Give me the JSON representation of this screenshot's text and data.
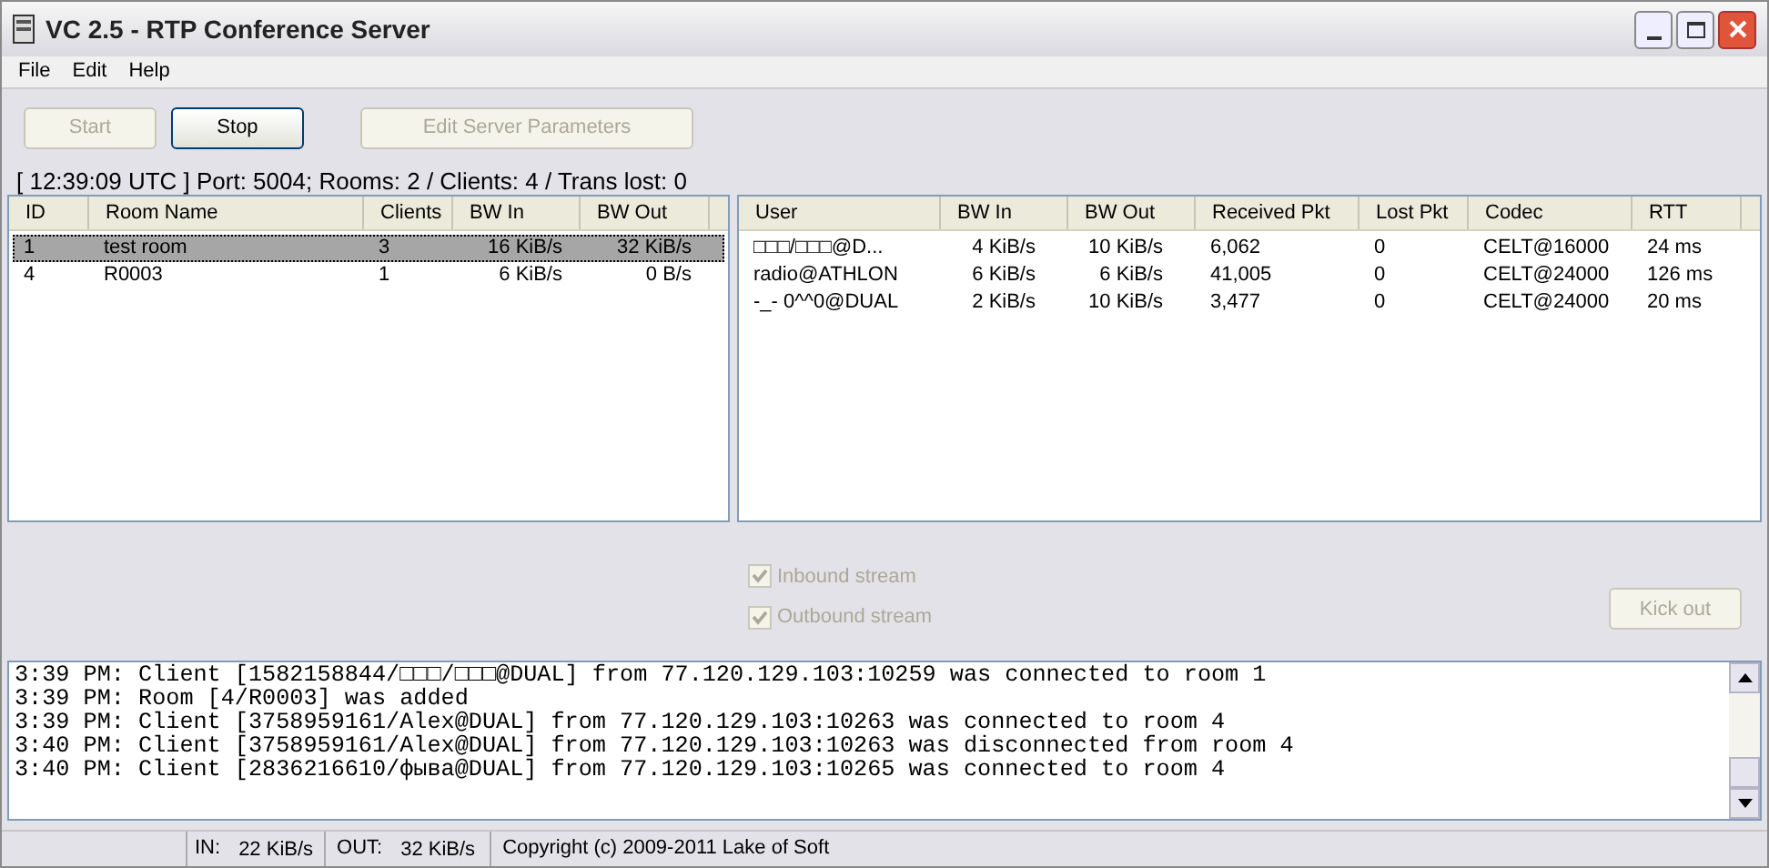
{
  "window": {
    "title": "VC 2.5 - RTP Conference Server"
  },
  "menu": [
    {
      "label": "File"
    },
    {
      "label": "Edit"
    },
    {
      "label": "Help"
    }
  ],
  "toolbar": [
    {
      "label": "Start",
      "disabled": true
    },
    {
      "label": "Stop",
      "disabled": false
    },
    {
      "label": "Edit Server Parameters",
      "disabled": true
    }
  ],
  "status_line": "[ 12:39:09 UTC ] Port: 5004; Rooms: 2 / Clients: 4 / Trans lost: 0",
  "rooms": {
    "columns": [
      "ID",
      "Room Name",
      "Clients",
      "BW In",
      "BW Out"
    ],
    "rows": [
      {
        "cells": [
          "1",
          "test room",
          "3",
          "16 KiB/s",
          "32 KiB/s"
        ],
        "selected": true
      },
      {
        "cells": [
          "4",
          "R0003",
          "1",
          "6 KiB/s",
          "0 B/s"
        ],
        "selected": false
      }
    ]
  },
  "users": {
    "columns": [
      "User",
      "BW In",
      "BW Out",
      "Received Pkt",
      "Lost Pkt",
      "Codec",
      "RTT"
    ],
    "rows": [
      {
        "cells": [
          "□□□/□□□@D...",
          "4 KiB/s",
          "10 KiB/s",
          "6,062",
          "0",
          "CELT@16000",
          "24 ms"
        ],
        "selected": false
      },
      {
        "cells": [
          "radio@ATHLON",
          "6 KiB/s",
          "6 KiB/s",
          "41,005",
          "0",
          "CELT@24000",
          "126 ms"
        ],
        "selected": false
      },
      {
        "cells": [
          "-_- 0^^0@DUAL",
          "2 KiB/s",
          "10 KiB/s",
          "3,477",
          "0",
          "CELT@24000",
          "20 ms"
        ],
        "selected": false
      }
    ]
  },
  "options": [
    {
      "label": "Inbound stream",
      "checked": true,
      "disabled": true
    },
    {
      "label": "Outbound stream",
      "checked": true,
      "disabled": true
    }
  ],
  "kick_button": {
    "label": "Kick out",
    "disabled": true
  },
  "log": [
    "3:39 PM: Client [1582158844/□□□/□□□@DUAL] from 77.120.129.103:10259 was connected to room 1",
    "3:39 PM: Room [4/R0003] was added",
    "3:39 PM: Client [3758959161/Alex@DUAL] from 77.120.129.103:10263 was connected to room 4",
    "3:40 PM: Client [3758959161/Alex@DUAL] from 77.120.129.103:10263 was disconnected from room 4",
    "3:40 PM: Client [2836216610/фыва@DUAL] from 77.120.129.103:10265 was connected to room 4"
  ],
  "status_bar": {
    "in_label": "IN:",
    "in_value": "22 KiB/s",
    "out_label": "OUT:",
    "out_value": "32 KiB/s",
    "copyright": "Copyright (c) 2009-2011 Lake of Soft"
  }
}
